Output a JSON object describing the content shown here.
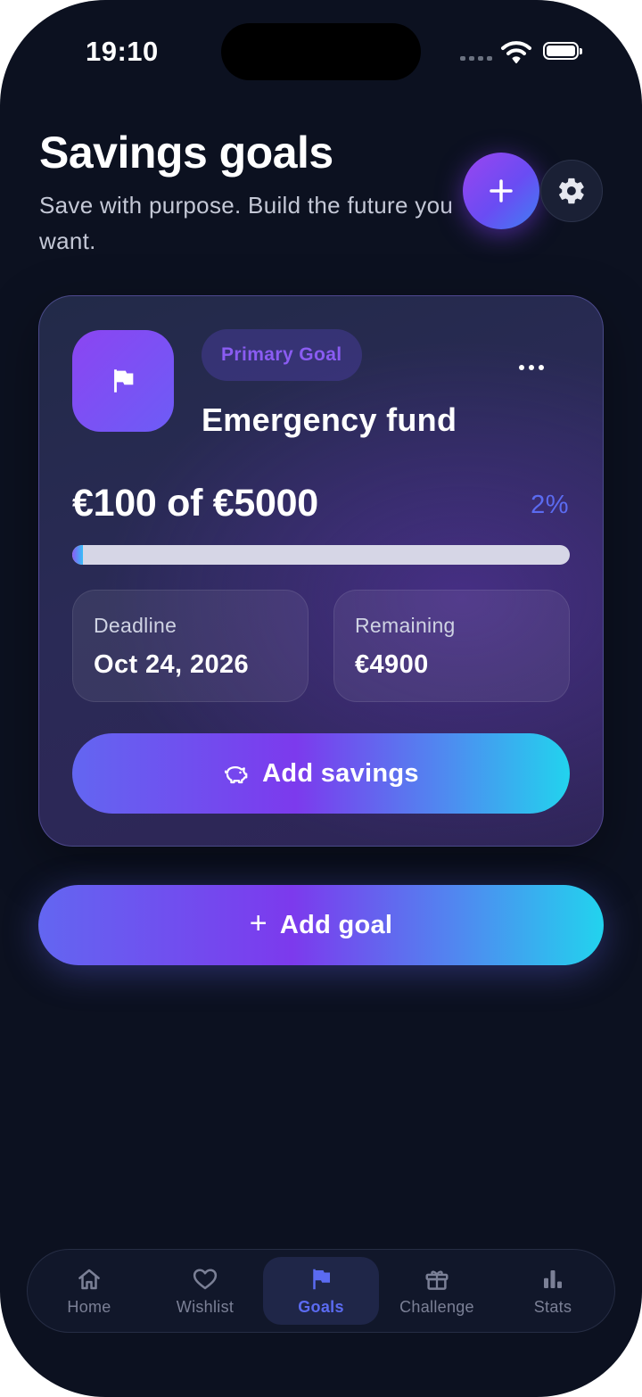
{
  "status_bar": {
    "time": "19:10"
  },
  "header": {
    "title": "Savings goals",
    "subtitle": "Save with purpose. Build the future you want."
  },
  "goal": {
    "badge": "Primary Goal",
    "name": "Emergency fund",
    "amount_text": "€100 of €5000",
    "percent_text": "2%",
    "progress_fraction": 0.02,
    "deadline": {
      "label": "Deadline",
      "value": "Oct 24, 2026"
    },
    "remaining": {
      "label": "Remaining",
      "value": "€4900"
    },
    "add_savings_label": "Add savings"
  },
  "add_goal": {
    "plus": "+",
    "label": "Add goal"
  },
  "tabs": [
    {
      "label": "Home",
      "icon": "home-icon"
    },
    {
      "label": "Wishlist",
      "icon": "heart-icon"
    },
    {
      "label": "Goals",
      "icon": "flag-icon",
      "active": true
    },
    {
      "label": "Challenge",
      "icon": "gift-icon"
    },
    {
      "label": "Stats",
      "icon": "bar-chart-icon"
    }
  ],
  "colors": {
    "background": "#0c1120",
    "accent": "#5b6bf1",
    "purple": "#7c3aed",
    "cyan": "#22d3ee"
  }
}
